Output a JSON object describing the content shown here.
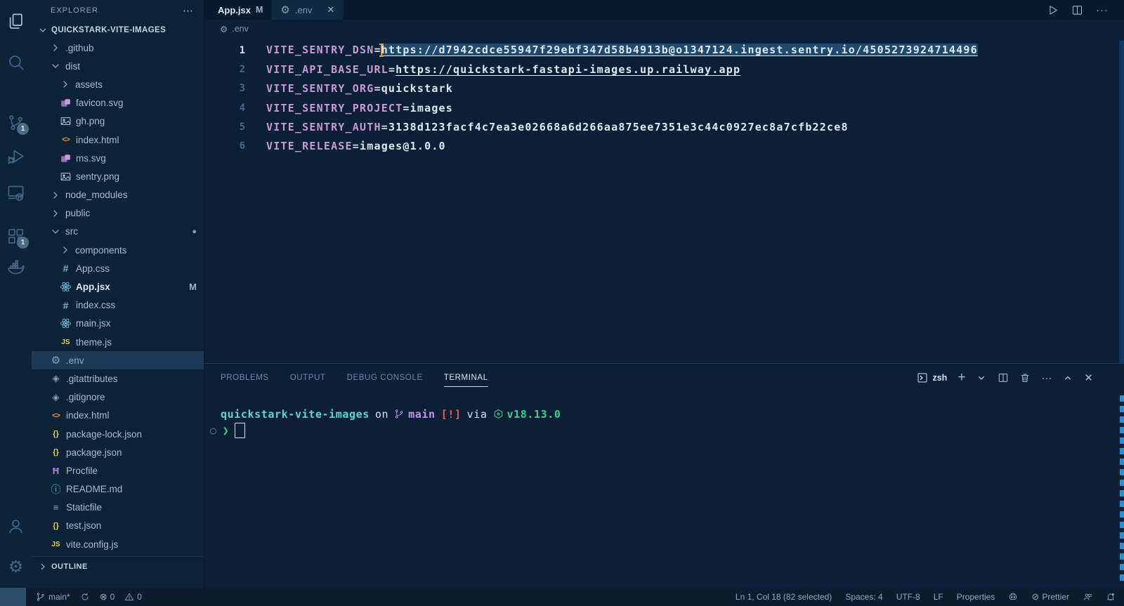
{
  "colors": {
    "bg-editor": "#0b2036",
    "bg-activity": "#0d2438",
    "bg-sidebar": "#0c2236",
    "bg-tabbar": "#081a2d",
    "bg-tab-active": "#102a41",
    "bg-status": "#0a1c2d",
    "bg-selected-row": "#1d3b56",
    "selection": "#1d4a6e",
    "key-purple": "#c79bd2",
    "text-code": "#dfeaf4",
    "cursor-orange": "#dca242",
    "term-cyan": "#5fd7cd",
    "term-purple": "#c792ea",
    "term-red": "#f2584c",
    "term-green": "#3ecf8e",
    "accent-blue": "#2b8fd4"
  },
  "activity_bar": {
    "top": [
      {
        "name": "explorer",
        "icon": "files-icon",
        "active": true
      },
      {
        "name": "search",
        "icon": "search-icon"
      },
      {
        "name": "source-control",
        "icon": "source-control-icon",
        "badge": "1"
      },
      {
        "name": "run-debug",
        "icon": "debug-icon"
      },
      {
        "name": "remote-explorer",
        "icon": "remote-explorer-icon"
      },
      {
        "name": "extensions",
        "icon": "extensions-icon",
        "badge": "1"
      },
      {
        "name": "docker",
        "icon": "docker-icon"
      }
    ],
    "bottom": [
      {
        "name": "account",
        "icon": "account-icon"
      },
      {
        "name": "settings",
        "icon": "gear-icon"
      }
    ]
  },
  "explorer": {
    "title": "EXPLORER",
    "more": "⋯",
    "root": "QUICKSTARK-VITE-IMAGES",
    "outline": "OUTLINE",
    "items": [
      {
        "label": ".github",
        "icon": "chevron-right",
        "indent": 1,
        "kind": "folder"
      },
      {
        "label": "dist",
        "icon": "chevron-down",
        "indent": 1,
        "kind": "folder"
      },
      {
        "label": "assets",
        "icon": "chevron-right",
        "indent": 2,
        "kind": "folder"
      },
      {
        "label": "favicon.svg",
        "icon": "svg-file-icon",
        "indent": 2
      },
      {
        "label": "gh.png",
        "icon": "image-file-icon",
        "indent": 2
      },
      {
        "label": "index.html",
        "icon": "html-file-icon",
        "indent": 2
      },
      {
        "label": "ms.svg",
        "icon": "svg-file-icon",
        "indent": 2
      },
      {
        "label": "sentry.png",
        "icon": "image-file-icon",
        "indent": 2
      },
      {
        "label": "node_modules",
        "icon": "chevron-right",
        "indent": 1,
        "kind": "folder"
      },
      {
        "label": "public",
        "icon": "chevron-right",
        "indent": 1,
        "kind": "folder"
      },
      {
        "label": "src",
        "icon": "chevron-down",
        "indent": 1,
        "kind": "folder",
        "trailing": "dot"
      },
      {
        "label": "components",
        "icon": "chevron-right",
        "indent": 2,
        "kind": "folder"
      },
      {
        "label": "App.css",
        "icon": "css-file-icon",
        "indent": 2
      },
      {
        "label": "App.jsx",
        "icon": "react-file-icon",
        "indent": 2,
        "trailing": "M",
        "bright": true
      },
      {
        "label": "index.css",
        "icon": "css-file-icon",
        "indent": 2
      },
      {
        "label": "main.jsx",
        "icon": "react-file-icon",
        "indent": 2
      },
      {
        "label": "theme.js",
        "icon": "js-file-icon",
        "indent": 2
      },
      {
        "label": ".env",
        "icon": "gear-file-icon",
        "indent": 1,
        "selected": true
      },
      {
        "label": ".gitattributes",
        "icon": "git-file-icon",
        "indent": 1
      },
      {
        "label": ".gitignore",
        "icon": "git-file-icon",
        "indent": 1
      },
      {
        "label": "index.html",
        "icon": "html-file-icon",
        "indent": 1
      },
      {
        "label": "package-lock.json",
        "icon": "json-file-icon",
        "indent": 1
      },
      {
        "label": "package.json",
        "icon": "json-file-icon",
        "indent": 1
      },
      {
        "label": "Procfile",
        "icon": "heroku-file-icon",
        "indent": 1
      },
      {
        "label": "README.md",
        "icon": "info-file-icon",
        "indent": 1
      },
      {
        "label": "Staticfile",
        "icon": "list-file-icon",
        "indent": 1
      },
      {
        "label": "test.json",
        "icon": "json-file-icon",
        "indent": 1
      },
      {
        "label": "vite.config.js",
        "icon": "js-file-icon",
        "indent": 1
      }
    ]
  },
  "editor": {
    "tabs": [
      {
        "label": "App.jsx",
        "icon": "react-file-icon",
        "badge": "M",
        "bright": true
      },
      {
        "label": ".env",
        "icon": "gear-file-icon",
        "active": true,
        "close": "✕"
      }
    ],
    "breadcrumb": {
      "icon": "gear-file-icon",
      "label": ".env"
    },
    "actions": [
      {
        "name": "run",
        "icon": "play-icon"
      },
      {
        "name": "split-editor",
        "icon": "split-icon"
      },
      {
        "name": "more-actions",
        "icon": "more-icon"
      }
    ],
    "lines": [
      {
        "num": "1",
        "key": "VITE_SENTRY_DSN",
        "value": "https://d7942cdce55947f29ebf347d58b4913b@o1347124.ingest.sentry.io/4505273924714496",
        "link": true,
        "selected": true,
        "cursor": true
      },
      {
        "num": "2",
        "key": "VITE_API_BASE_URL",
        "value": "https://quickstark-fastapi-images.up.railway.app",
        "link": true
      },
      {
        "num": "3",
        "key": "VITE_SENTRY_ORG",
        "value": "quickstark"
      },
      {
        "num": "4",
        "key": "VITE_SENTRY_PROJECT",
        "value": "images"
      },
      {
        "num": "5",
        "key": "VITE_SENTRY_AUTH",
        "value": "3138d123facf4c7ea3e02668a6d266aa875ee7351e3c44c0927ec8a7cfb22ce8"
      },
      {
        "num": "6",
        "key": "VITE_RELEASE",
        "value": "images@1.0.0"
      }
    ]
  },
  "panel": {
    "tabs": [
      {
        "label": "PROBLEMS"
      },
      {
        "label": "OUTPUT"
      },
      {
        "label": "DEBUG CONSOLE"
      },
      {
        "label": "TERMINAL",
        "active": true
      }
    ],
    "shell": "zsh",
    "actions": [
      {
        "name": "new-terminal",
        "icon": "plus-icon"
      },
      {
        "name": "launch-profile-dropdown",
        "icon": "chevron-down-small"
      },
      {
        "name": "split-terminal",
        "icon": "split-icon"
      },
      {
        "name": "kill-terminal",
        "icon": "trash-icon"
      },
      {
        "name": "more-actions",
        "icon": "more-icon"
      },
      {
        "name": "maximize-panel",
        "icon": "chevron-up-small"
      },
      {
        "name": "close-panel",
        "icon": "close-icon"
      }
    ],
    "terminal": {
      "prompt_segments": [
        {
          "text": "quickstark-vite-images",
          "style": "cyan"
        },
        {
          "text": "on",
          "style": "plain"
        },
        {
          "icon": "git-branch-icon",
          "text": "main",
          "style": "purple"
        },
        {
          "text": "[!]",
          "style": "red"
        },
        {
          "text": "via",
          "style": "plain"
        },
        {
          "icon": "node-icon",
          "text": "v18.13.0",
          "style": "green"
        }
      ],
      "prompt_prefix": "○",
      "prompt_symbol": "❯"
    }
  },
  "status_bar": {
    "left": [
      {
        "name": "remote",
        "icon": "remote-icon"
      },
      {
        "name": "branch",
        "icon": "git-branch-icon",
        "label": "main*"
      },
      {
        "name": "sync",
        "icon": "sync-icon"
      },
      {
        "name": "errors",
        "icon": "error-icon",
        "label": "0"
      },
      {
        "name": "warnings",
        "icon": "warning-icon",
        "label": "0"
      }
    ],
    "right": [
      {
        "name": "cursor-position",
        "label": "Ln 1, Col 18 (82 selected)"
      },
      {
        "name": "indentation",
        "label": "Spaces: 4"
      },
      {
        "name": "encoding",
        "label": "UTF-8"
      },
      {
        "name": "eol",
        "label": "LF"
      },
      {
        "name": "language-mode",
        "label": "Properties"
      },
      {
        "name": "copilot",
        "icon": "copilot-icon"
      },
      {
        "name": "formatter",
        "icon": "prettier-icon",
        "label": "Prettier"
      },
      {
        "name": "feedback",
        "icon": "feedback-icon"
      },
      {
        "name": "notifications",
        "icon": "bell-icon"
      }
    ]
  }
}
